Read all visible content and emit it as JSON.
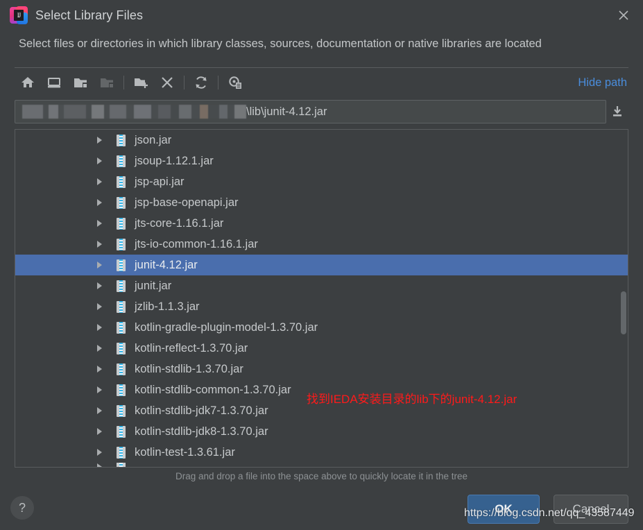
{
  "window": {
    "title": "Select Library Files",
    "logo_text": "IJ",
    "close_icon": "close-icon"
  },
  "description": "Select files or directories in which library classes, sources, documentation or native libraries are located",
  "toolbar": {
    "buttons": [
      {
        "name": "home-icon",
        "tooltip": "Home",
        "disabled": false
      },
      {
        "name": "desktop-icon",
        "tooltip": "Desktop",
        "disabled": false
      },
      {
        "name": "folder-open-icon",
        "tooltip": "Project",
        "disabled": false
      },
      {
        "name": "folder-up-icon",
        "tooltip": "Module",
        "disabled": true
      },
      {
        "name": "new-folder-icon",
        "tooltip": "New Folder",
        "disabled": false
      },
      {
        "name": "delete-icon",
        "tooltip": "Delete",
        "disabled": false
      },
      {
        "name": "refresh-icon",
        "tooltip": "Refresh",
        "disabled": false
      },
      {
        "name": "show-hidden-icon",
        "tooltip": "Show Hidden Files",
        "disabled": false
      }
    ],
    "hide_path_label": "Hide path"
  },
  "path": {
    "redacted_prefix": "",
    "visible_text": "\\lib\\junit-4.12.jar",
    "import_icon": "download-icon"
  },
  "tree": {
    "items": [
      {
        "label": "json.jar",
        "selected": false
      },
      {
        "label": "jsoup-1.12.1.jar",
        "selected": false
      },
      {
        "label": "jsp-api.jar",
        "selected": false
      },
      {
        "label": "jsp-base-openapi.jar",
        "selected": false
      },
      {
        "label": "jts-core-1.16.1.jar",
        "selected": false
      },
      {
        "label": "jts-io-common-1.16.1.jar",
        "selected": false
      },
      {
        "label": "junit-4.12.jar",
        "selected": true
      },
      {
        "label": "junit.jar",
        "selected": false
      },
      {
        "label": "jzlib-1.1.3.jar",
        "selected": false
      },
      {
        "label": "kotlin-gradle-plugin-model-1.3.70.jar",
        "selected": false
      },
      {
        "label": "kotlin-reflect-1.3.70.jar",
        "selected": false
      },
      {
        "label": "kotlin-stdlib-1.3.70.jar",
        "selected": false
      },
      {
        "label": "kotlin-stdlib-common-1.3.70.jar",
        "selected": false
      },
      {
        "label": "kotlin-stdlib-jdk7-1.3.70.jar",
        "selected": false
      },
      {
        "label": "kotlin-stdlib-jdk8-1.3.70.jar",
        "selected": false
      },
      {
        "label": "kotlin-test-1.3.61.jar",
        "selected": false
      }
    ]
  },
  "annotation": {
    "text": "找到IEDA安装目录的lib下的junit-4.12.jar",
    "color": "#ff1a1a"
  },
  "drag_hint": "Drag and drop a file into the space above to quickly locate it in the tree",
  "buttons": {
    "help_label": "?",
    "ok_label": "OK",
    "cancel_label": "Cancel"
  },
  "watermark": "https://blog.csdn.net/qq_43587449",
  "colors": {
    "background": "#3c3f41",
    "selection": "#4a6ead",
    "link": "#4a8ddc",
    "ok_button": "#36618f",
    "text": "#c6c9cb"
  }
}
